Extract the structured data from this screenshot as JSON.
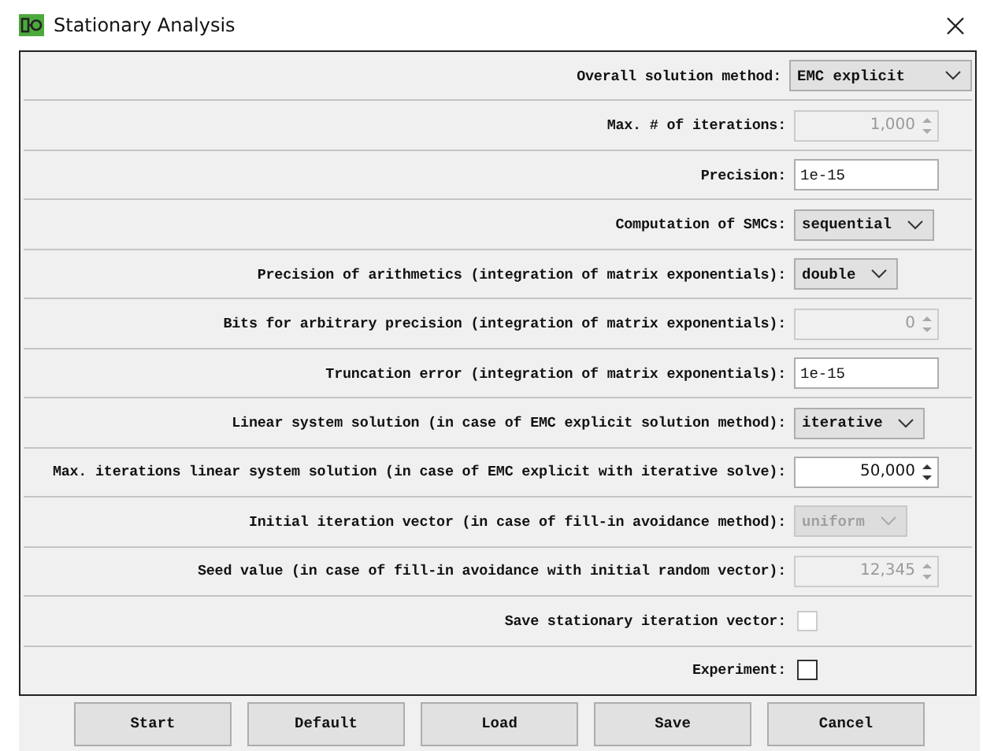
{
  "window": {
    "title": "Stationary Analysis"
  },
  "rows": [
    {
      "label": "Overall solution method:",
      "kind": "dropdown",
      "value": "EMC explicit",
      "disabled": false
    },
    {
      "label": "Max. # of iterations:",
      "kind": "spinner",
      "value": "1,000",
      "disabled": true
    },
    {
      "label": "Precision:",
      "kind": "text",
      "value": "1e-15",
      "disabled": false
    },
    {
      "label": "Computation of SMCs:",
      "kind": "dropdown",
      "value": "sequential",
      "disabled": false
    },
    {
      "label": "Precision of arithmetics (integration of matrix exponentials):",
      "kind": "dropdown",
      "value": "double",
      "disabled": false
    },
    {
      "label": "Bits for arbitrary precision (integration of matrix exponentials):",
      "kind": "spinner",
      "value": "0",
      "disabled": true
    },
    {
      "label": "Truncation error (integration of matrix exponentials):",
      "kind": "text",
      "value": "1e-15",
      "disabled": false
    },
    {
      "label": "Linear system solution (in case of EMC explicit solution method):",
      "kind": "dropdown",
      "value": "iterative",
      "disabled": false
    },
    {
      "label": "Max. iterations linear system solution (in case of EMC explicit with iterative solve):",
      "kind": "spinner",
      "value": "50,000",
      "disabled": false
    },
    {
      "label": "Initial iteration vector (in case of fill-in avoidance method):",
      "kind": "dropdown",
      "value": "uniform",
      "disabled": true
    },
    {
      "label": "Seed value (in case of fill-in avoidance with initial random vector):",
      "kind": "spinner",
      "value": "12,345",
      "disabled": true
    },
    {
      "label": "Save stationary iteration vector:",
      "kind": "checkbox",
      "checked": false,
      "disabled": true
    },
    {
      "label": "Experiment:",
      "kind": "checkbox",
      "checked": false,
      "disabled": false
    }
  ],
  "buttons": [
    "Start",
    "Default",
    "Load",
    "Save",
    "Cancel"
  ]
}
